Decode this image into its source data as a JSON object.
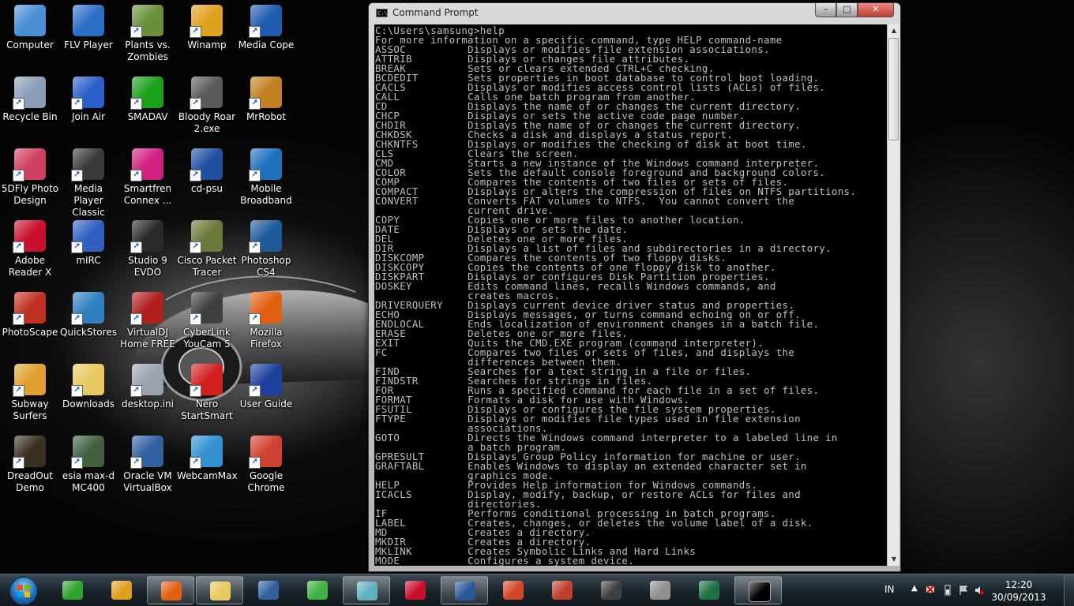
{
  "desktop": {
    "icons": [
      {
        "label": "Computer",
        "icon": "computer-icon",
        "color": "#4a8fd6"
      },
      {
        "label": "FLV Player",
        "icon": "flv-player-icon",
        "color": "#2c6fc4"
      },
      {
        "label": "Plants vs. Zombies",
        "icon": "plants-vs-zombies-icon",
        "color": "#6a8f3a"
      },
      {
        "label": "Winamp",
        "icon": "winamp-icon",
        "color": "#e0a020"
      },
      {
        "label": "Media Cope",
        "icon": "media-cope-icon",
        "color": "#1f5bb0"
      },
      {
        "label": "Recycle Bin",
        "icon": "recycle-bin-icon",
        "color": "#8aa0b8"
      },
      {
        "label": "Join Air",
        "icon": "join-air-icon",
        "color": "#2a5ec8"
      },
      {
        "label": "SMADAV",
        "icon": "smadav-icon",
        "color": "#1aa01a"
      },
      {
        "label": "Bloody Roar 2.exe",
        "icon": "bloody-roar-icon",
        "color": "#5a5a5a"
      },
      {
        "label": "MrRobot",
        "icon": "mrrobot-icon",
        "color": "#c08020"
      },
      {
        "label": "5DFly Photo Design",
        "icon": "5dfly-icon",
        "color": "#d04060"
      },
      {
        "label": "Media Player Classic",
        "icon": "media-player-classic-icon",
        "color": "#3a3a3a"
      },
      {
        "label": "Smartfren Connex ...",
        "icon": "smartfren-icon",
        "color": "#d02080"
      },
      {
        "label": "cd-psu",
        "icon": "cd-psu-icon",
        "color": "#2050a0"
      },
      {
        "label": "Mobile Broadband",
        "icon": "mobile-broadband-icon",
        "color": "#2070c0"
      },
      {
        "label": "Adobe Reader X",
        "icon": "adobe-reader-icon",
        "color": "#c8102e"
      },
      {
        "label": "mIRC",
        "icon": "mirc-icon",
        "color": "#3060c0"
      },
      {
        "label": "Studio 9 EVDO",
        "icon": "studio9-icon",
        "color": "#2a2a2a"
      },
      {
        "label": "Cisco Packet Tracer",
        "icon": "cisco-packet-tracer-icon",
        "color": "#6a7a3a"
      },
      {
        "label": "Photoshop CS4",
        "icon": "photoshop-icon",
        "color": "#1d5a9a"
      },
      {
        "label": "PhotoScape",
        "icon": "photoscape-icon",
        "color": "#c03020"
      },
      {
        "label": "QuickStores",
        "icon": "quickstores-icon",
        "color": "#3080c0"
      },
      {
        "label": "VirtualDJ Home FREE",
        "icon": "virtualdj-icon",
        "color": "#b02020"
      },
      {
        "label": "CyberLink YouCam 5",
        "icon": "youcam-icon",
        "color": "#404040"
      },
      {
        "label": "Mozilla Firefox",
        "icon": "firefox-icon",
        "color": "#e06010"
      },
      {
        "label": "Subway Surfers",
        "icon": "subway-surfers-icon",
        "color": "#e0a030"
      },
      {
        "label": "Downloads",
        "icon": "downloads-folder-icon",
        "color": "#e8c860"
      },
      {
        "label": "desktop.ini",
        "icon": "ini-file-icon",
        "color": "#9aa4ae"
      },
      {
        "label": "Nero StartSmart",
        "icon": "nero-icon",
        "color": "#d02020"
      },
      {
        "label": "User Guide",
        "icon": "user-guide-icon",
        "color": "#2040a0"
      },
      {
        "label": "DreadOut Demo",
        "icon": "dreadout-icon",
        "color": "#3a3020"
      },
      {
        "label": "esia max-d MC400",
        "icon": "esia-icon",
        "color": "#406040"
      },
      {
        "label": "Oracle VM VirtualBox",
        "icon": "virtualbox-icon",
        "color": "#3060a0"
      },
      {
        "label": "WebcamMax",
        "icon": "webcammax-icon",
        "color": "#3090d0"
      },
      {
        "label": "Google Chrome",
        "icon": "chrome-icon",
        "color": "#d04030"
      }
    ]
  },
  "cmd_window": {
    "title": "Command Prompt",
    "title_icon_text": "C:\\",
    "minimize": "–",
    "maximize": "□",
    "close": "✕",
    "prompt_line": "C:\\Users\\samsung>help",
    "lines": [
      "For more information on a specific command, type HELP command-name",
      "ASSOC          Displays or modifies file extension associations.",
      "ATTRIB         Displays or changes file attributes.",
      "BREAK          Sets or clears extended CTRL+C checking.",
      "BCDEDIT        Sets properties in boot database to control boot loading.",
      "CACLS          Displays or modifies access control lists (ACLs) of files.",
      "CALL           Calls one batch program from another.",
      "CD             Displays the name of or changes the current directory.",
      "CHCP           Displays or sets the active code page number.",
      "CHDIR          Displays the name of or changes the current directory.",
      "CHKDSK         Checks a disk and displays a status report.",
      "CHKNTFS        Displays or modifies the checking of disk at boot time.",
      "CLS            Clears the screen.",
      "CMD            Starts a new instance of the Windows command interpreter.",
      "COLOR          Sets the default console foreground and background colors.",
      "COMP           Compares the contents of two files or sets of files.",
      "COMPACT        Displays or alters the compression of files on NTFS partitions.",
      "CONVERT        Converts FAT volumes to NTFS.  You cannot convert the",
      "               current drive.",
      "COPY           Copies one or more files to another location.",
      "DATE           Displays or sets the date.",
      "DEL            Deletes one or more files.",
      "DIR            Displays a list of files and subdirectories in a directory.",
      "DISKCOMP       Compares the contents of two floppy disks.",
      "DISKCOPY       Copies the contents of one floppy disk to another.",
      "DISKPART       Displays or configures Disk Partition properties.",
      "DOSKEY         Edits command lines, recalls Windows commands, and",
      "               creates macros.",
      "DRIVERQUERY    Displays current device driver status and properties.",
      "ECHO           Displays messages, or turns command echoing on or off.",
      "ENDLOCAL       Ends localization of environment changes in a batch file.",
      "ERASE          Deletes one or more files.",
      "EXIT           Quits the CMD.EXE program (command interpreter).",
      "FC             Compares two files or sets of files, and displays the",
      "               differences between them.",
      "FIND           Searches for a text string in a file or files.",
      "FINDSTR        Searches for strings in files.",
      "FOR            Runs a specified command for each file in a set of files.",
      "FORMAT         Formats a disk for use with Windows.",
      "FSUTIL         Displays or configures the file system properties.",
      "FTYPE          Displays or modifies file types used in file extension",
      "               associations.",
      "GOTO           Directs the Windows command interpreter to a labeled line in",
      "               a batch program.",
      "GPRESULT       Displays Group Policy information for machine or user.",
      "GRAFTABL       Enables Windows to display an extended character set in",
      "               graphics mode.",
      "HELP           Provides Help information for Windows commands.",
      "ICACLS         Display, modify, backup, or restore ACLs for files and",
      "               directories.",
      "IF             Performs conditional processing in batch programs.",
      "LABEL          Creates, changes, or deletes the volume label of a disk.",
      "MD             Creates a directory.",
      "MKDIR          Creates a directory.",
      "MKLINK         Creates Symbolic Links and Hard Links",
      "MODE           Configures a system device."
    ]
  },
  "taskbar": {
    "start_icon": "windows-start-orb",
    "buttons": [
      {
        "name": "taskbar-btn-green-app",
        "icon": "green-app-icon",
        "color": "#2fa32f",
        "active": false
      },
      {
        "name": "taskbar-btn-winamp",
        "icon": "winamp-icon",
        "color": "#e0a020",
        "active": false
      },
      {
        "name": "taskbar-btn-firefox",
        "icon": "firefox-icon",
        "color": "#e06010",
        "active": true
      },
      {
        "name": "taskbar-btn-explorer",
        "icon": "folder-icon",
        "color": "#e8c860",
        "active": true
      },
      {
        "name": "taskbar-btn-virtualbox",
        "icon": "virtualbox-icon",
        "color": "#3060a0",
        "active": false
      },
      {
        "name": "taskbar-btn-green-orb",
        "icon": "green-orb-icon",
        "color": "#40b040",
        "active": false
      },
      {
        "name": "taskbar-btn-notes",
        "icon": "notes-icon",
        "color": "#60b0c0",
        "active": true
      },
      {
        "name": "taskbar-btn-adobe",
        "icon": "adobe-reader-icon",
        "color": "#c8102e",
        "active": false
      },
      {
        "name": "taskbar-btn-word",
        "icon": "word-icon",
        "color": "#2b5797",
        "active": true
      },
      {
        "name": "taskbar-btn-powerpoint",
        "icon": "powerpoint-icon",
        "color": "#d24726",
        "active": false
      },
      {
        "name": "taskbar-btn-book",
        "icon": "book-icon",
        "color": "#c04030",
        "active": false
      },
      {
        "name": "taskbar-btn-youcam",
        "icon": "youcam-icon",
        "color": "#404040",
        "active": false
      },
      {
        "name": "taskbar-btn-game",
        "icon": "game-emblem-icon",
        "color": "#909090",
        "active": false
      },
      {
        "name": "taskbar-btn-excel",
        "icon": "excel-icon",
        "color": "#1e7145",
        "active": false
      },
      {
        "name": "taskbar-btn-cmd",
        "icon": "command-prompt-icon",
        "color": "#000000",
        "active": true
      }
    ],
    "tray": {
      "language": "IN",
      "show_hidden": "▲",
      "time": "12:20",
      "date": "30/09/2013"
    }
  }
}
